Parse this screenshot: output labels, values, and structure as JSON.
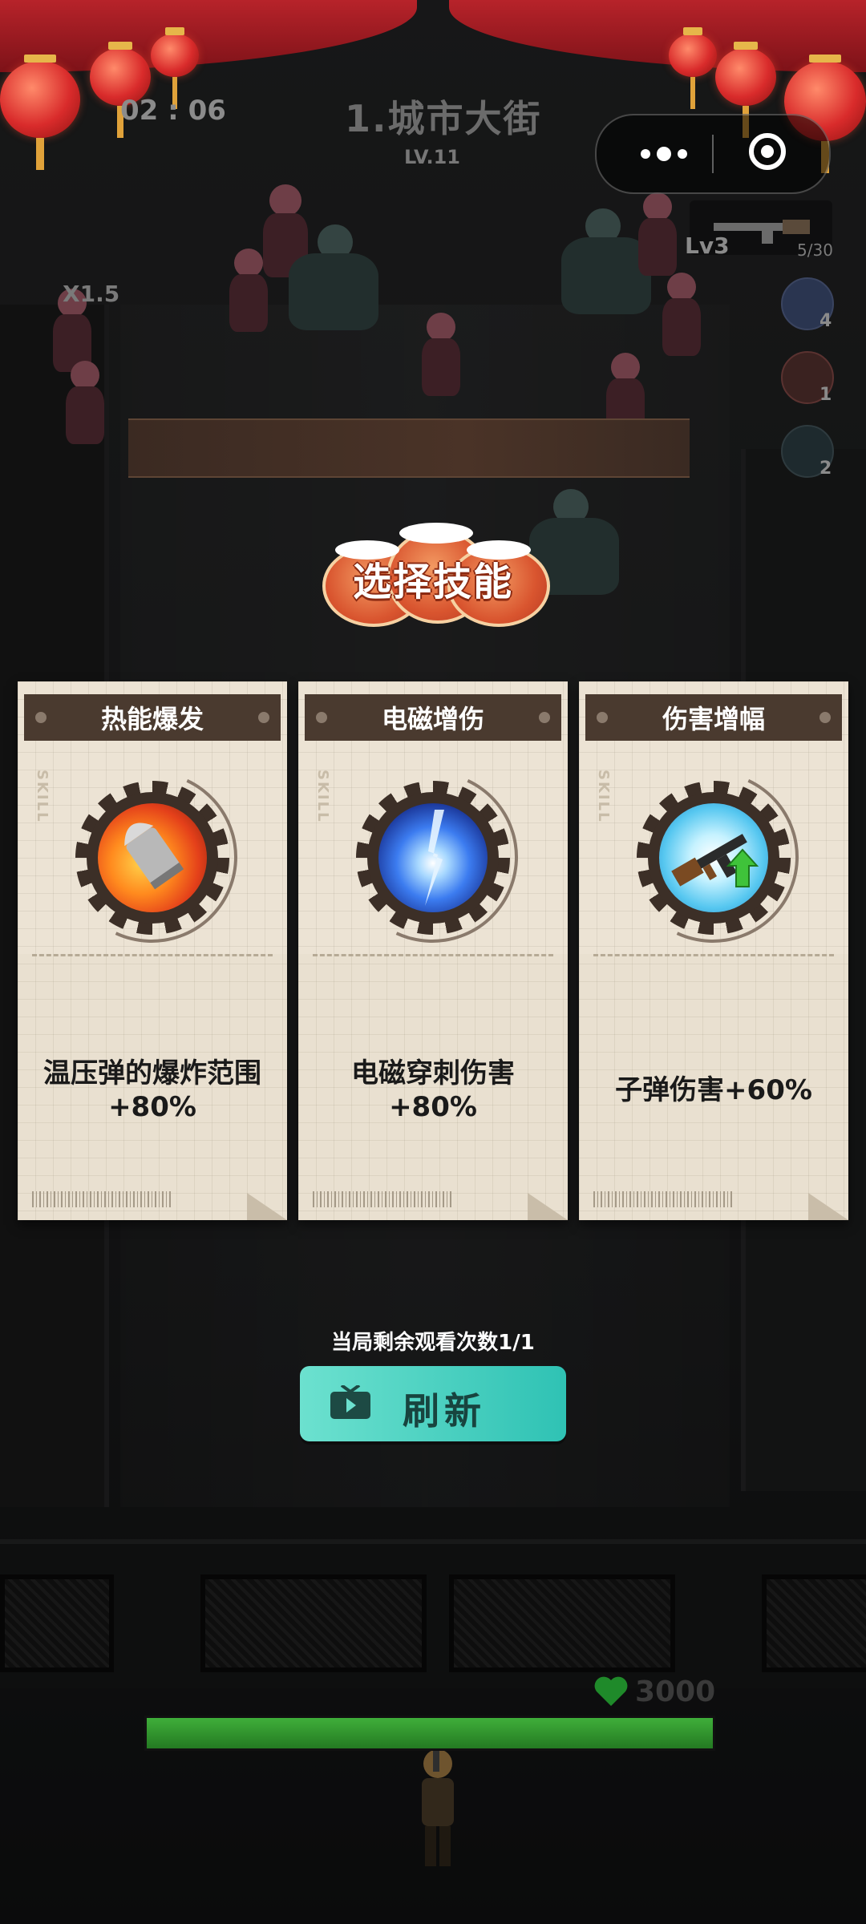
{
  "hud": {
    "timer": "02 : 06",
    "level_title": "1.城市大街",
    "level_sub": "LV.11",
    "speed": "X1.5",
    "weapon_level": "Lv3",
    "ammo": "5/30",
    "side_skill_counts": [
      "4",
      "1",
      "2"
    ]
  },
  "menu_capsule": {
    "more_icon": "more-dots-icon",
    "close_icon": "target-circle-icon"
  },
  "select_title": "选择技能",
  "cards": [
    {
      "name": "热能爆发",
      "tag": "SKILL",
      "icon": "thermobaric-bullet-icon",
      "desc": "温压弹的爆炸范围+80%"
    },
    {
      "name": "电磁增伤",
      "tag": "SKILL",
      "icon": "electromagnetic-pierce-icon",
      "desc": "电磁穿刺伤害+80%"
    },
    {
      "name": "伤害增幅",
      "tag": "SKILL",
      "icon": "rifle-upgrade-icon",
      "desc": "子弹伤害+60%"
    }
  ],
  "refresh": {
    "count_text": "当局剩余观看次数1/1",
    "button_label": "刷新",
    "icon": "tv-video-icon"
  },
  "base": {
    "hp_value": "3000",
    "hp_fraction": 1.0
  },
  "colors": {
    "card_header": "#4a3a2f",
    "card_paper": "#ece3d4",
    "refresh_button": "#3fd0bf",
    "hp_green": "#3fae3a",
    "title_orange": "#d9552f"
  }
}
